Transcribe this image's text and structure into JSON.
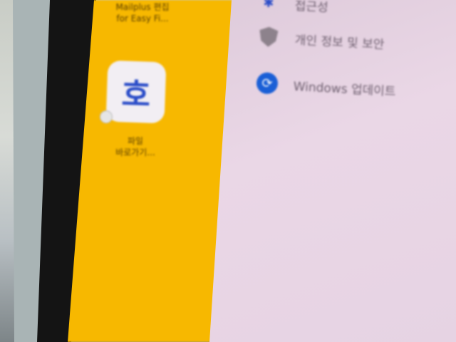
{
  "desktop": {
    "icons": [
      {
        "label_line1": "Mailplus 편집",
        "label_line2": "for Easy Fi..."
      },
      {
        "glyph": "호",
        "label_line1": "파일",
        "label_line2": "바로가기..."
      }
    ]
  },
  "settings_menu": {
    "items": [
      {
        "label": "접근성",
        "icon": "accessibility-icon"
      },
      {
        "label": "개인 정보 및 보안",
        "icon": "shield-icon"
      },
      {
        "label": "Windows 업데이트",
        "icon": "windows-update-icon"
      }
    ]
  },
  "colors": {
    "desktop_background": "#f7b800",
    "panel_background": "#ead7e6",
    "update_icon": "#1a5fd6"
  }
}
